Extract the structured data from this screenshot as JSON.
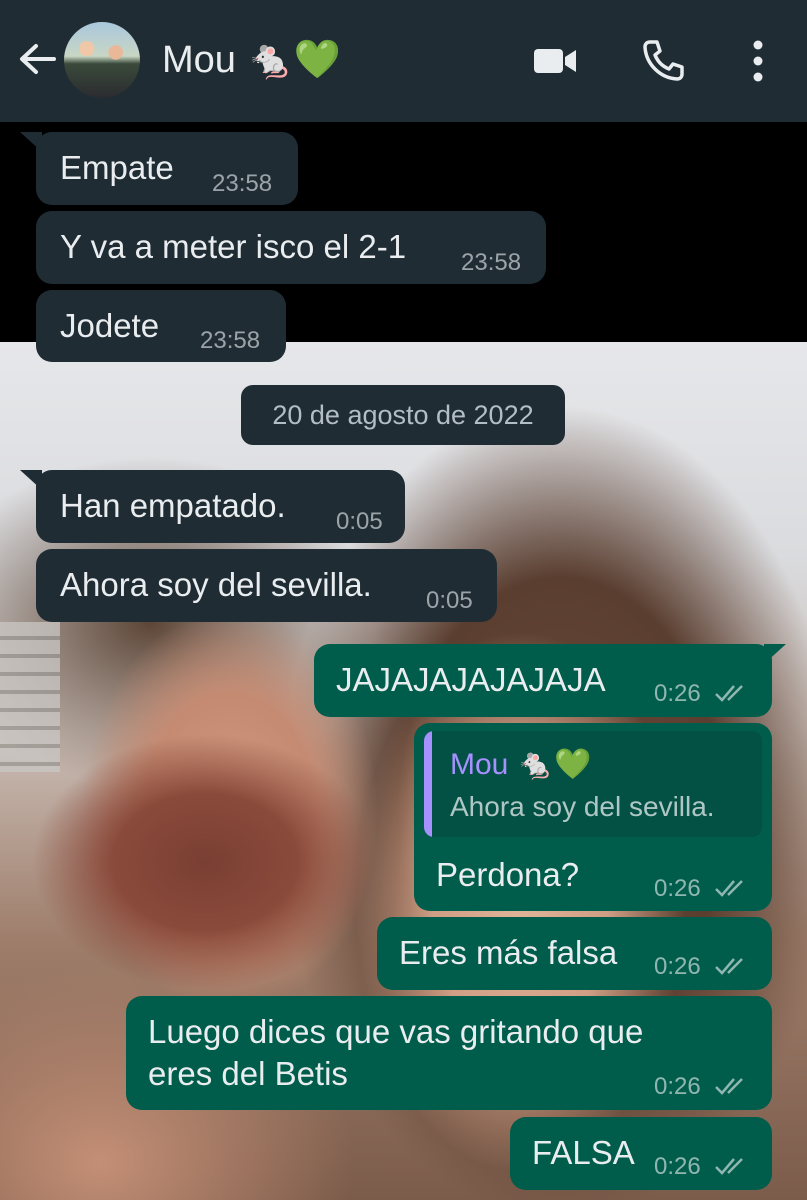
{
  "header": {
    "contact_name": "Mou 🐁💚",
    "icons": [
      "back-arrow-icon",
      "contact-avatar",
      "video-call-icon",
      "phone-icon",
      "more-vert-icon"
    ]
  },
  "date_separator": "20 de agosto de 2022",
  "messages": [
    {
      "direction": "in",
      "text": "Empate",
      "time": "23:58"
    },
    {
      "direction": "in",
      "text": "Y va a meter isco el 2-1",
      "time": "23:58"
    },
    {
      "direction": "in",
      "text": "Jodete",
      "time": "23:58"
    },
    {
      "direction": "in",
      "text": "Han empatado.",
      "time": "0:05"
    },
    {
      "direction": "in",
      "text": "Ahora soy del sevilla.",
      "time": "0:05"
    },
    {
      "direction": "out",
      "text": "JAJAJAJAJAJAJA",
      "time": "0:26",
      "status": "delivered"
    },
    {
      "direction": "out",
      "text": "Perdona?",
      "time": "0:26",
      "status": "delivered",
      "reply_to": {
        "author": "Mou 🐁💚",
        "text": "Ahora soy del sevilla."
      }
    },
    {
      "direction": "out",
      "text": "Eres más falsa",
      "time": "0:26",
      "status": "delivered"
    },
    {
      "direction": "out",
      "text_lines": [
        "Luego dices que vas gritando que",
        "eres del Betis"
      ],
      "time": "0:26",
      "status": "delivered"
    },
    {
      "direction": "out",
      "text": "FALSA",
      "time": "0:26",
      "status": "delivered"
    }
  ],
  "colors": {
    "header_bg": "#1f2c34",
    "incoming_bubble": "#1f2c34",
    "outgoing_bubble": "#005c4b",
    "quote_accent": "#a791ff"
  }
}
